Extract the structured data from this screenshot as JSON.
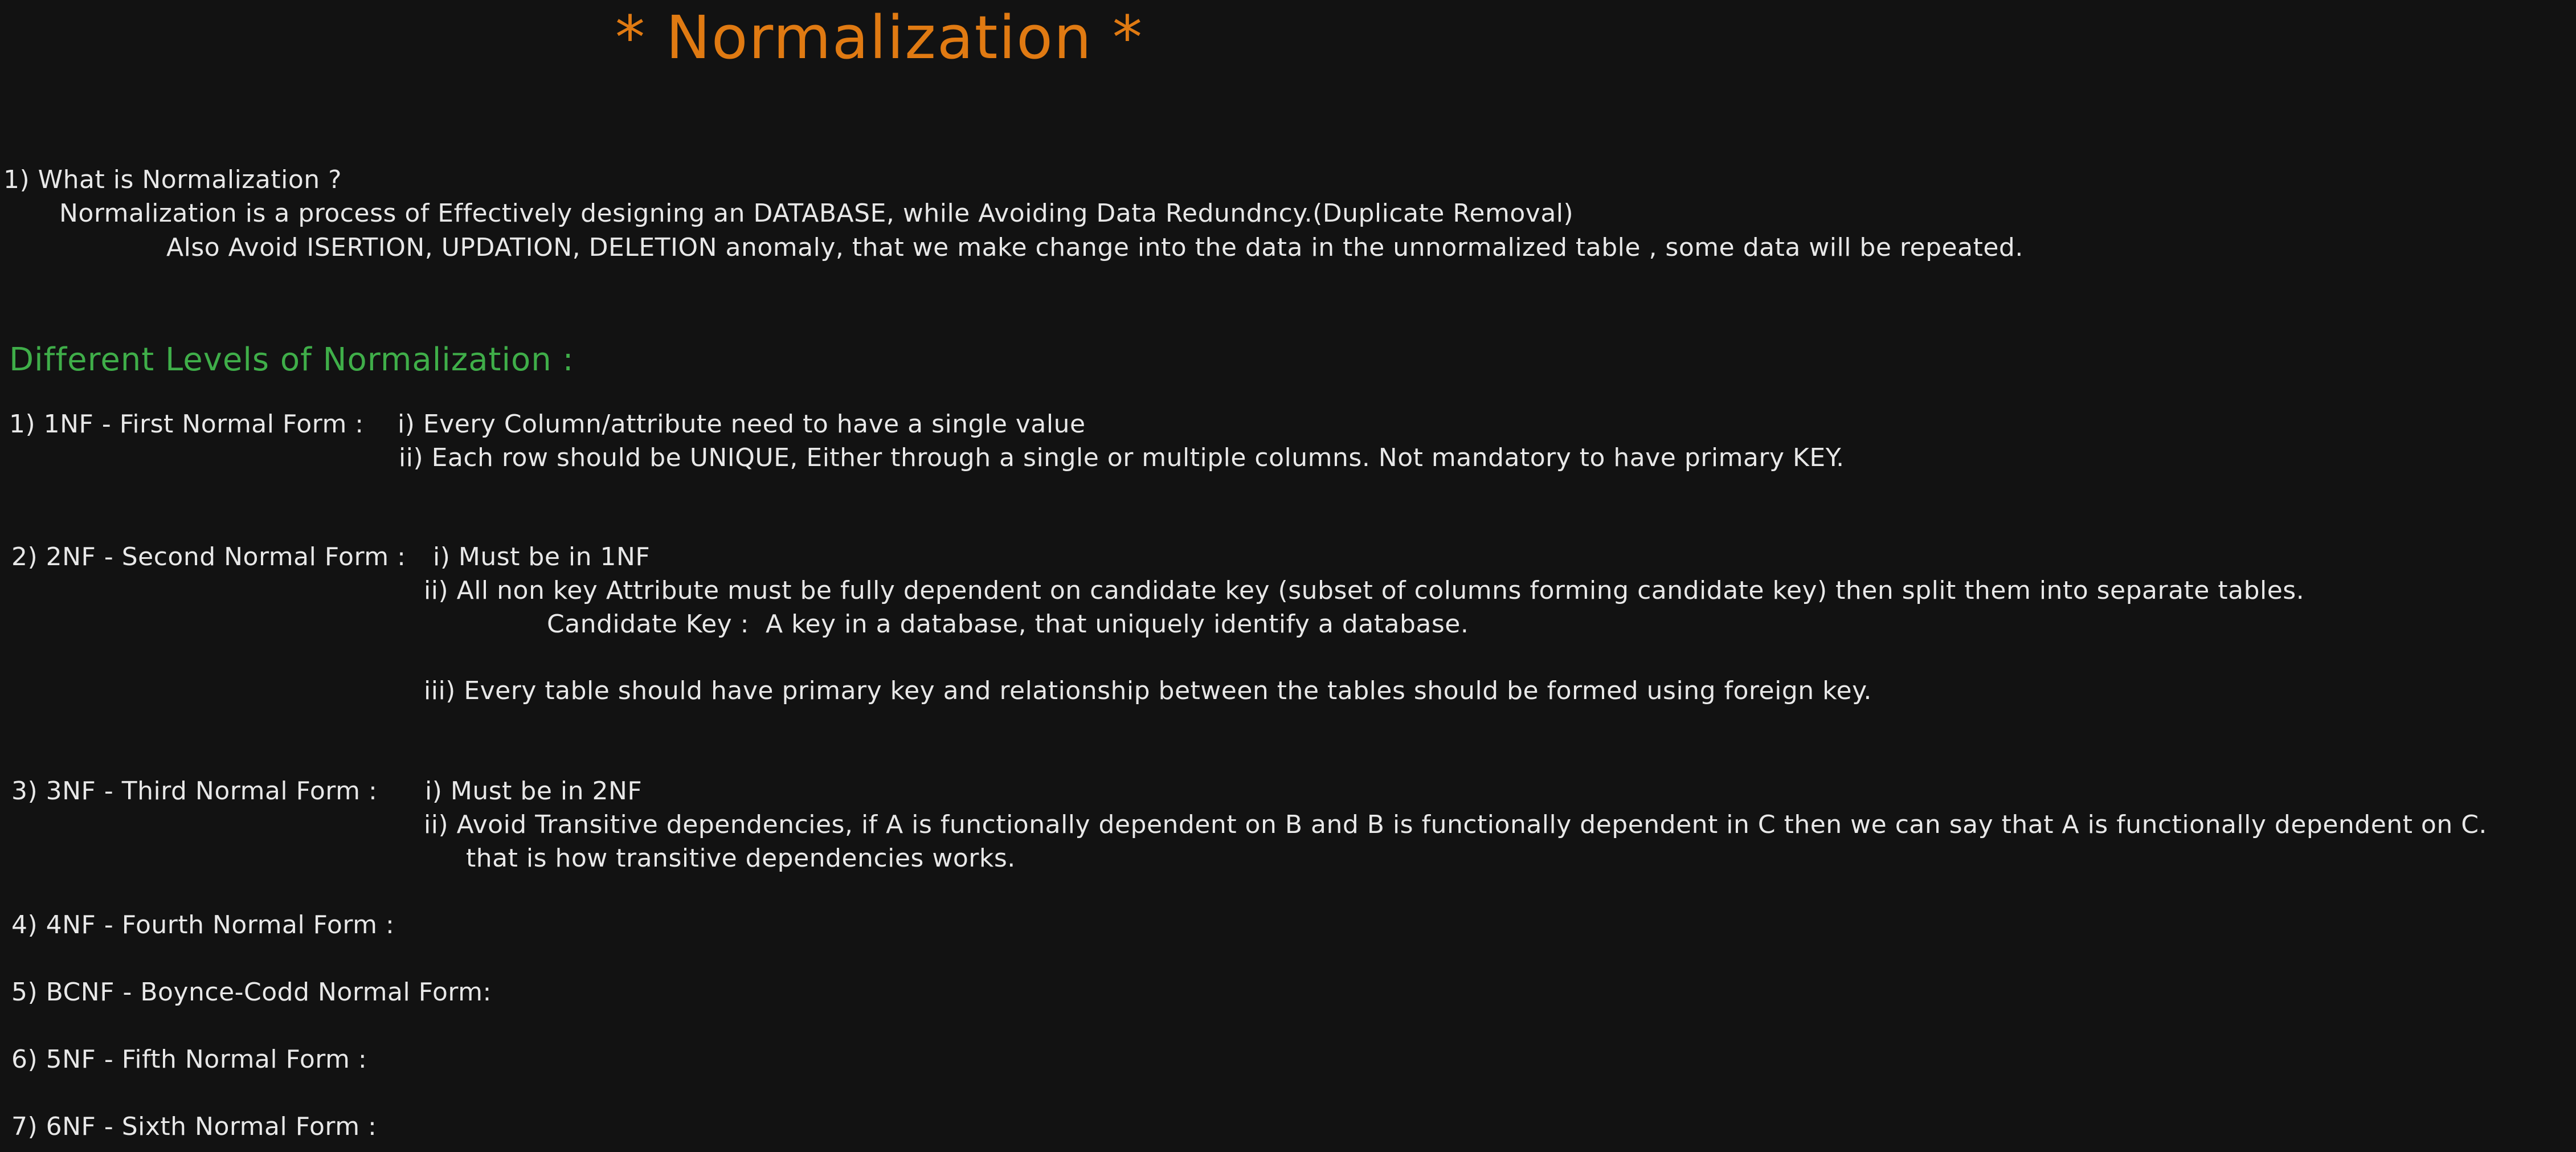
{
  "colors": {
    "background": "#121212",
    "title": "#e07a12",
    "heading": "#3fae49",
    "text": "#e8e8e8"
  },
  "title": "* Normalization *",
  "intro": {
    "question": "1) What is Normalization ?",
    "line1": "Normalization is a process of Effectively designing an DATABASE, while Avoiding Data Redundncy.(Duplicate Removal)",
    "line2": "Also Avoid ISERTION, UPDATION, DELETION anomaly, that we make change into the data in the unnormalized table , some data will be repeated."
  },
  "levels_heading": "Different Levels of Normalization :",
  "nf1": {
    "label": "1) 1NF - First Normal Form :",
    "rule1": "i) Every Column/attribute need to have a single value",
    "rule2": "ii) Each row should be UNIQUE, Either through a single or multiple columns. Not mandatory to have primary KEY."
  },
  "nf2": {
    "label": "2) 2NF - Second Normal Form :",
    "rule1": "i) Must be in 1NF",
    "rule2": "ii) All non key Attribute must be fully dependent on candidate key (subset of columns forming candidate key) then split them into separate tables.",
    "candidate": "Candidate Key :  A key in a database, that uniquely identify a database.",
    "rule3": "iii) Every table should have primary key and relationship between the tables should be formed using foreign key."
  },
  "nf3": {
    "label": "3) 3NF - Third Normal Form :",
    "rule1": "i) Must be in 2NF",
    "rule2": "ii) Avoid Transitive dependencies, if A is functionally dependent on B and B is functionally dependent in C then we can say that A is functionally dependent on C.",
    "rule2_cont": "that is how transitive dependencies works."
  },
  "nf4": {
    "label": "4) 4NF - Fourth Normal Form :"
  },
  "bcnf": {
    "label": "5) BCNF - Boynce-Codd Normal Form:"
  },
  "nf5": {
    "label": "6) 5NF - Fifth Normal Form :"
  },
  "nf6": {
    "label": "7) 6NF - Sixth Normal Form :"
  }
}
